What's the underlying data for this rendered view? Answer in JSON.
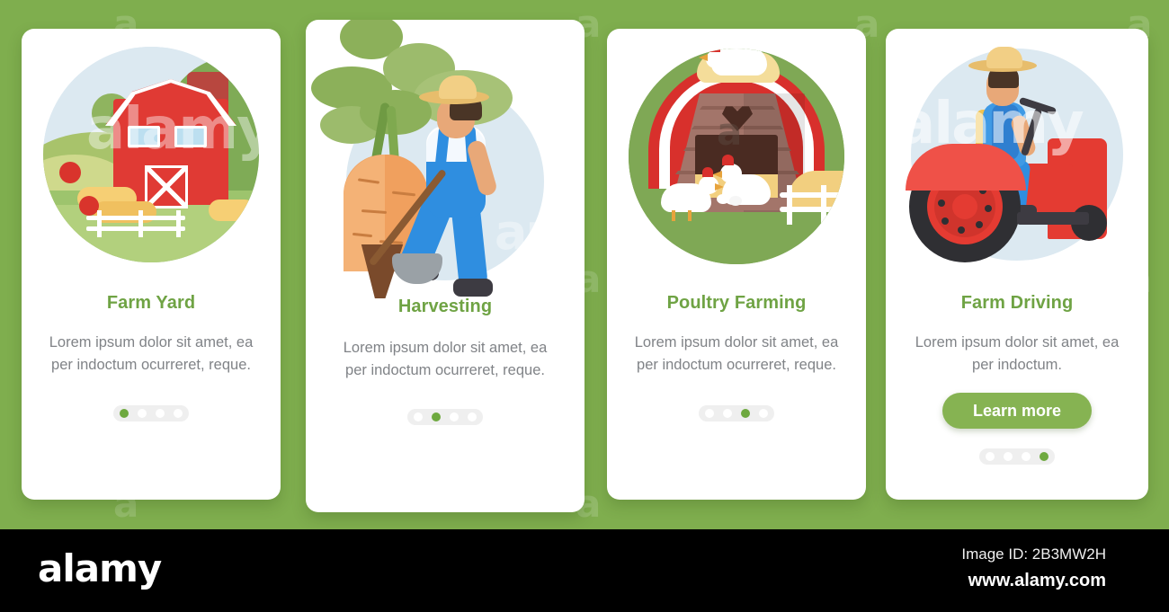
{
  "background": {
    "color": "#7fae4e",
    "watermark_text": "a"
  },
  "cards": [
    {
      "id": "farm-yard",
      "title": "Farm Yard",
      "description": "Lorem ipsum dolor sit amet, ea per indoctum ocurreret, reque.",
      "illustration": "barn-illustration",
      "disc_color": "#dce9f1",
      "button": null,
      "pagination": {
        "count": 4,
        "active": 0
      }
    },
    {
      "id": "harvesting",
      "title": "Harvesting",
      "description": "Lorem ipsum dolor sit amet, ea per indoctum ocurreret, reque.",
      "illustration": "carrot-farmer-illustration",
      "disc_color": "#dce9f1",
      "button": null,
      "pagination": {
        "count": 4,
        "active": 1
      }
    },
    {
      "id": "poultry-farming",
      "title": "Poultry Farming",
      "description": "Lorem ipsum dolor sit amet, ea per indoctum ocurreret, reque.",
      "illustration": "chicken-coop-illustration",
      "disc_color": "#7fa855",
      "button": null,
      "pagination": {
        "count": 4,
        "active": 2
      }
    },
    {
      "id": "farm-driving",
      "title": "Farm Driving",
      "description": "Lorem ipsum dolor sit amet, ea per indoctum.",
      "illustration": "tractor-illustration",
      "disc_color": "#dce9f1",
      "button": {
        "label": "Learn more"
      },
      "pagination": {
        "count": 4,
        "active": 3
      }
    }
  ],
  "footer": {
    "logo": "alamy",
    "image_id": "Image ID: 2B3MW2H",
    "url": "www.alamy.com"
  },
  "colors": {
    "background_green": "#7fae4e",
    "title_green": "#6fa344",
    "button_green": "#86b352",
    "body_gray": "#808387",
    "dot_active": "#6ea93f",
    "pager_track": "#efefef",
    "footer_bg": "#000000"
  }
}
